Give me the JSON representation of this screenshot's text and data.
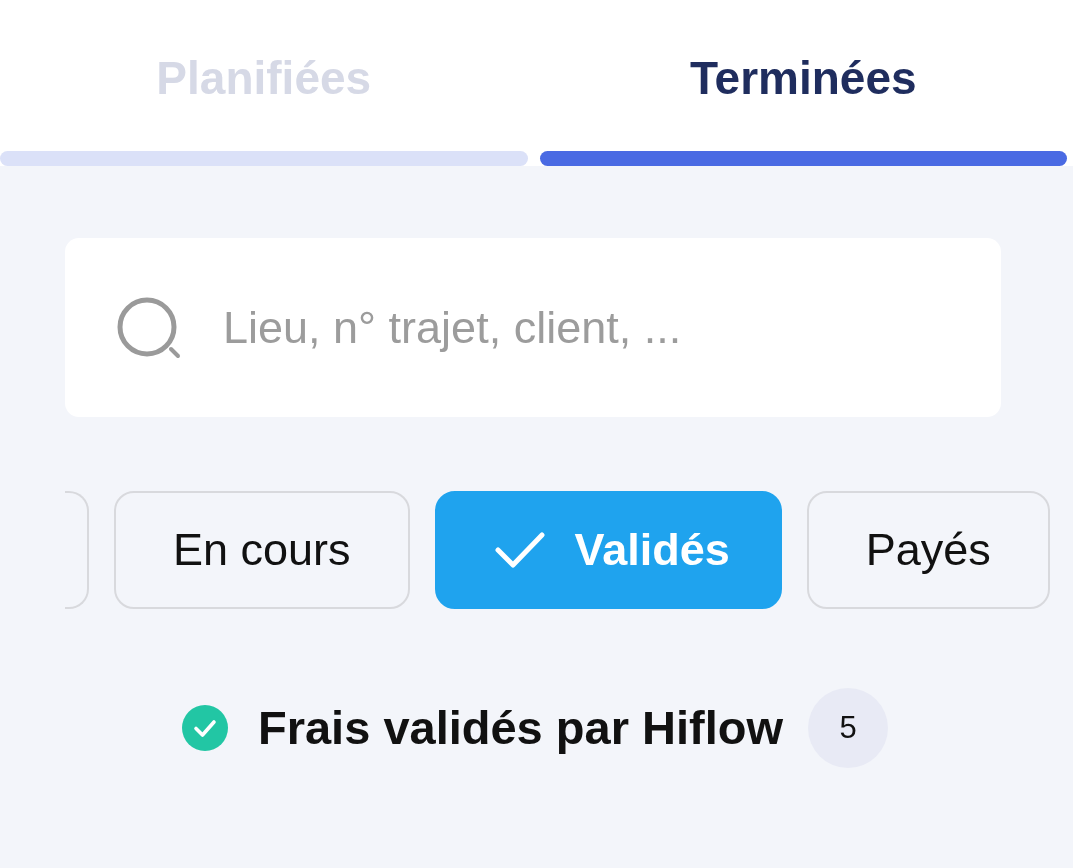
{
  "tabs": [
    {
      "label": "Planifiées",
      "selected": false
    },
    {
      "label": "Terminées",
      "selected": true
    }
  ],
  "search": {
    "placeholder": "Lieu, n° trajet, client, ..."
  },
  "filters": [
    {
      "kind": "clipped",
      "selected": false
    },
    {
      "kind": "chip",
      "label": "En cours",
      "selected": false
    },
    {
      "kind": "chip",
      "label": "Validés",
      "selected": true
    },
    {
      "kind": "chip",
      "label": "Payés",
      "selected": false
    }
  ],
  "status": {
    "label": "Frais validés par Hiflow",
    "count": "5",
    "validated": true
  }
}
